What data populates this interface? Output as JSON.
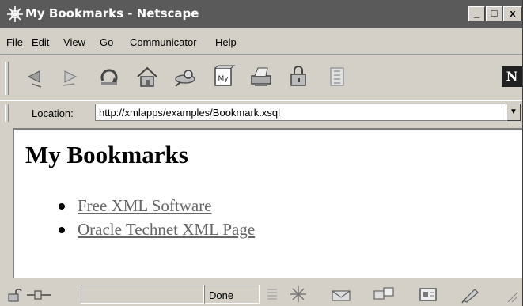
{
  "window": {
    "title": "My Bookmarks - Netscape",
    "controls": {
      "minimize": "_",
      "maximize": "□",
      "close": "x"
    }
  },
  "menubar": {
    "items": [
      {
        "label": "File",
        "underline": "F",
        "rest": "ile"
      },
      {
        "label": "Edit",
        "underline": "E",
        "rest": "dit"
      },
      {
        "label": "View",
        "underline": "V",
        "rest": "iew"
      },
      {
        "label": "Go",
        "underline": "G",
        "rest": "o"
      },
      {
        "label": "Communicator",
        "underline": "C",
        "rest": "ommunicator"
      },
      {
        "label": "Help",
        "underline": "H",
        "rest": "elp"
      }
    ]
  },
  "toolbar": {
    "buttons": [
      {
        "icon": "back-icon"
      },
      {
        "icon": "forward-icon"
      },
      {
        "icon": "reload-icon"
      },
      {
        "icon": "home-icon"
      },
      {
        "icon": "search-icon"
      },
      {
        "icon": "my-netscape-icon",
        "text": "My"
      },
      {
        "icon": "print-icon"
      },
      {
        "icon": "security-icon"
      },
      {
        "icon": "stop-icon"
      }
    ],
    "logo_text": "N"
  },
  "location": {
    "label": "Location:",
    "url": "http://xmlapps/examples/Bookmark.xsql"
  },
  "content": {
    "heading": "My Bookmarks",
    "bookmarks": [
      {
        "label": "Free XML Software"
      },
      {
        "label": "Oracle Technet XML Page"
      }
    ]
  },
  "statusbar": {
    "status": "Done"
  },
  "colors": {
    "titlebar": "#5a5a5a",
    "chrome": "#d4d0c8",
    "link": "#666666"
  }
}
